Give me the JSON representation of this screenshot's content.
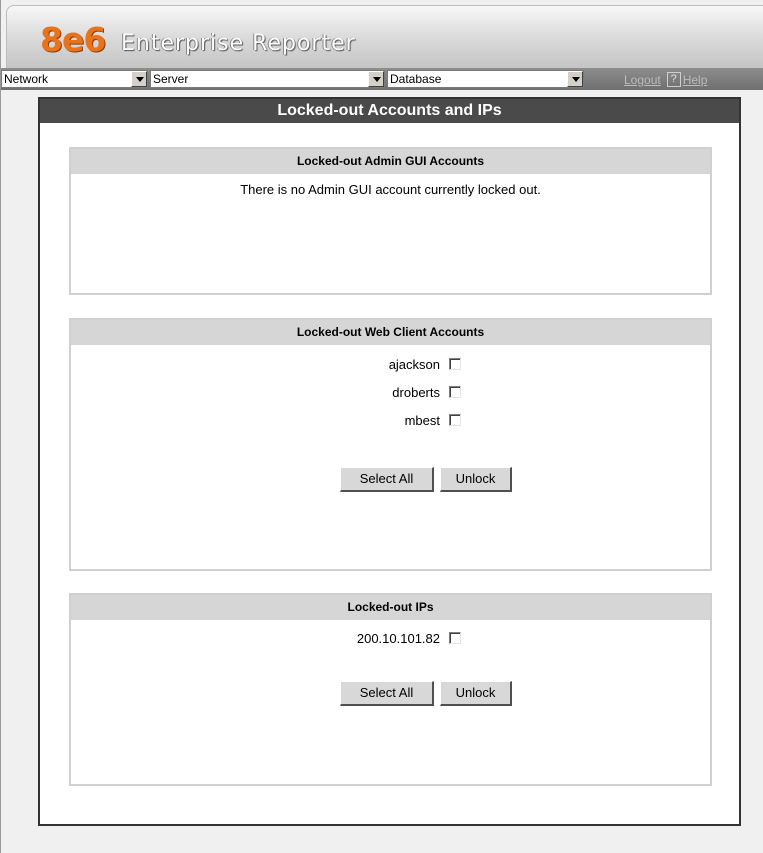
{
  "header": {
    "logo_mark": "8e6",
    "app_name": "Enterprise Reporter"
  },
  "toolbar": {
    "network": {
      "value": "Network"
    },
    "server": {
      "value": "Server"
    },
    "database": {
      "value": "Database"
    },
    "logout_label": "Logout",
    "help_icon_text": "?",
    "help_label": "Help"
  },
  "page": {
    "title": "Locked-out Accounts and IPs"
  },
  "admin_gui": {
    "title": "Locked-out Admin GUI Accounts",
    "message": "There is no Admin GUI account currently locked out."
  },
  "web_client": {
    "title": "Locked-out Web Client Accounts",
    "accounts": [
      {
        "name": "ajackson",
        "checked": false
      },
      {
        "name": "droberts",
        "checked": false
      },
      {
        "name": "mbest",
        "checked": false
      }
    ],
    "select_all_label": "Select All",
    "unlock_label": "Unlock"
  },
  "ips": {
    "title": "Locked-out IPs",
    "items": [
      {
        "ip": "200.10.101.82",
        "checked": false
      }
    ],
    "select_all_label": "Select All",
    "unlock_label": "Unlock"
  },
  "colors": {
    "logo_orange": "#e8731a",
    "title_bar": "#4a4a4a",
    "section_header": "#d6d6d6"
  }
}
